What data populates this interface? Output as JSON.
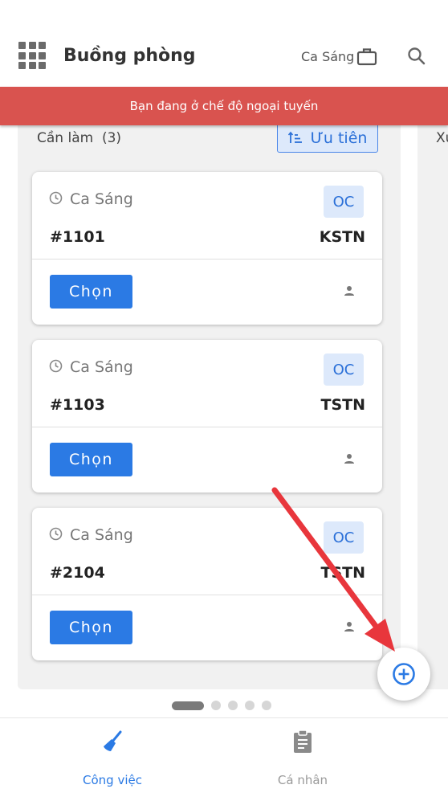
{
  "header": {
    "title": "Buồng phòng",
    "shift": "Ca Sáng",
    "icons": [
      "apps-grid-icon",
      "briefcase-icon",
      "search-icon"
    ]
  },
  "banner": {
    "text": "Bạn đang ở chế độ ngoại tuyến",
    "color": "#d9534f"
  },
  "column": {
    "title": "Cần làm  (3)",
    "sort_label": "Ưu tiên",
    "next_title": "Xu"
  },
  "cards": [
    {
      "shift": "Ca Sáng",
      "type": "OC",
      "room": "#1101",
      "status": "KSTN",
      "button": "Chọn"
    },
    {
      "shift": "Ca Sáng",
      "type": "OC",
      "room": "#1103",
      "status": "TSTN",
      "button": "Chọn"
    },
    {
      "shift": "Ca Sáng",
      "type": "OC",
      "room": "#2104",
      "status": "TSTN",
      "button": "Chọn"
    }
  ],
  "pager": {
    "pages": 5,
    "current": 1
  },
  "nav": {
    "work_label": "Công việc",
    "personal_label": "Cá nhân"
  },
  "colors": {
    "accent": "#2b7ae4",
    "badge_bg": "#dde9fb",
    "annotation_arrow": "#e8363c"
  }
}
